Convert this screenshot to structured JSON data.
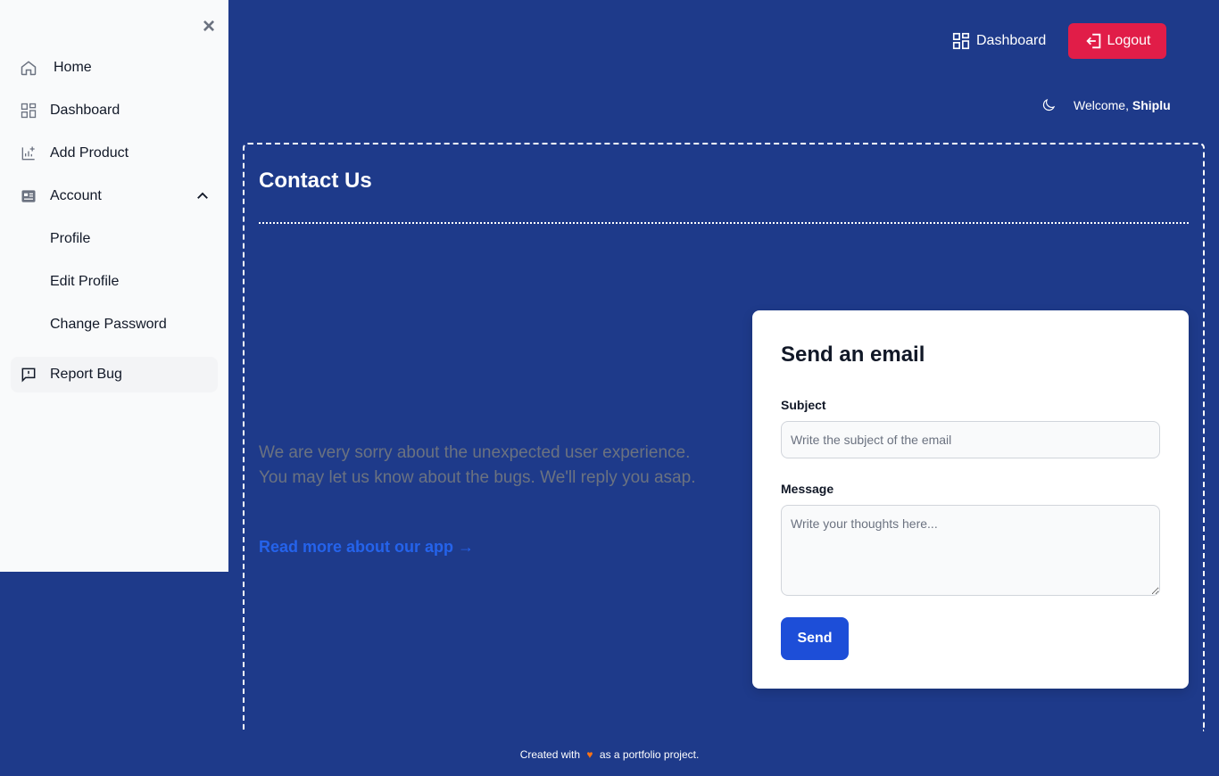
{
  "sidebar": {
    "items": [
      {
        "label": "Home",
        "icon": "home-icon"
      },
      {
        "label": "Dashboard",
        "icon": "dashboard-icon"
      },
      {
        "label": "Add Product",
        "icon": "add-chart-icon"
      },
      {
        "label": "Account",
        "icon": "account-card-icon"
      },
      {
        "label": "Profile"
      },
      {
        "label": "Edit Profile"
      },
      {
        "label": "Change Password"
      },
      {
        "label": "Report Bug",
        "icon": "report-bug-icon"
      }
    ]
  },
  "header": {
    "dashboard_label": "Dashboard",
    "logout_label": "Logout",
    "welcome_prefix": "Welcome,",
    "user_name": "Shiplu"
  },
  "main": {
    "title": "Contact Us",
    "intro": "We are very sorry about the unexpected user experience. You may let us know about the bugs. We'll reply you asap.",
    "read_more": "Read more about our app",
    "read_more_arrow": "→"
  },
  "form": {
    "title": "Send an email",
    "subject_label": "Subject",
    "subject_placeholder": "Write the subject of the email",
    "message_label": "Message",
    "message_placeholder": "Write your thoughts here...",
    "send_label": "Send"
  },
  "footer": {
    "prefix": "Created with",
    "heart": "♥",
    "suffix": "as a portfolio project."
  },
  "colors": {
    "background": "#1e3a8a",
    "logout": "#e11d48",
    "send": "#1d4ed8",
    "link": "#2563eb"
  }
}
